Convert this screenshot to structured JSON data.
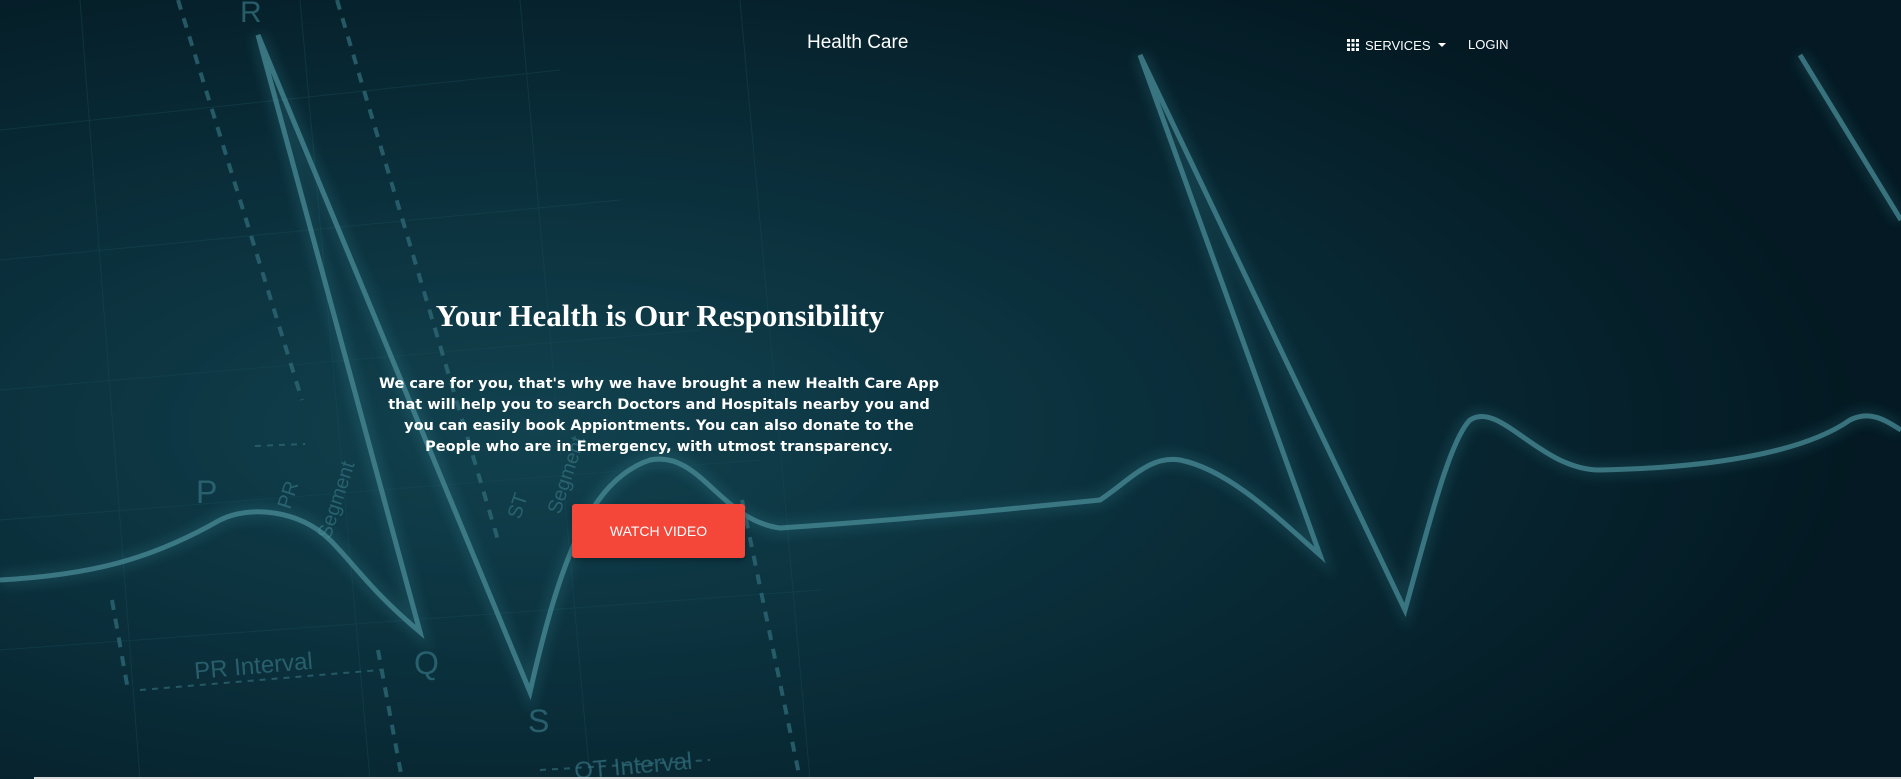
{
  "navbar": {
    "brand": "Health Care",
    "services_label": "SERVICES",
    "login_label": "LOGIN",
    "services_icon": "grid-icon",
    "dropdown_icon": "caret-down-icon"
  },
  "hero": {
    "title": "Your Health is Our Responsibility",
    "description": "We care for you, that's why we have brought a new Health Care App that will help you to search Doctors and Hospitals nearby you and you can easily book Appiontments. You can also donate to the People who are in Emergency, with utmost transparency.",
    "button_label": "WATCH VIDEO",
    "accent_color": "#f4473a"
  },
  "background": {
    "ecg_labels": [
      "R",
      "P",
      "Q",
      "S",
      "PR Segment",
      "ST Segment",
      "PR Interval",
      "QT Interval"
    ]
  }
}
